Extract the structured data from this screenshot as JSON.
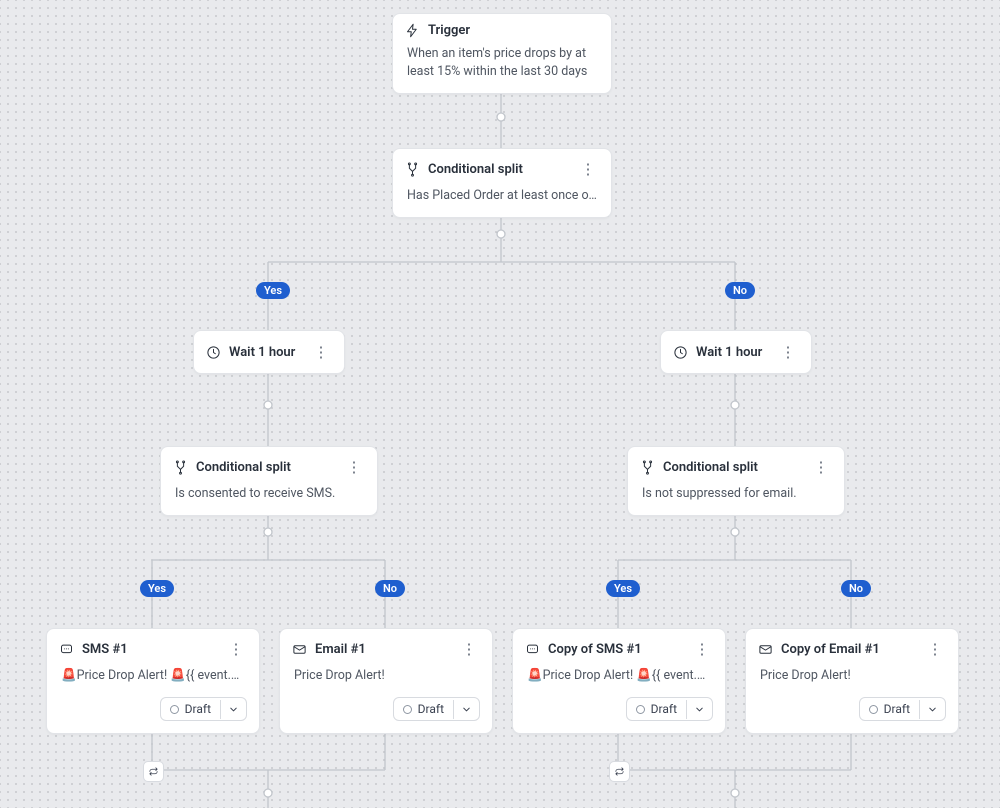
{
  "trigger": {
    "title": "Trigger",
    "desc": "When an item's price drops by at least 15% within the last 30 days"
  },
  "split1": {
    "title": "Conditional split",
    "desc": "Has Placed Order at least once over all ti…"
  },
  "branchLabels": {
    "yes": "Yes",
    "no": "No"
  },
  "waitL": {
    "title": "Wait 1 hour"
  },
  "waitR": {
    "title": "Wait 1 hour"
  },
  "split2L": {
    "title": "Conditional split",
    "desc": "Is consented to receive SMS."
  },
  "split2R": {
    "title": "Conditional split",
    "desc": "Is not suppressed for email."
  },
  "msg": {
    "sms1": {
      "title": "SMS #1",
      "desc": "🚨Price Drop Alert! 🚨{{ event.product_n…",
      "status": "Draft"
    },
    "email1": {
      "title": "Email #1",
      "desc": "Price Drop Alert!",
      "status": "Draft"
    },
    "sms2": {
      "title": "Copy of SMS #1",
      "desc": "🚨Price Drop Alert! 🚨{{ event.product_n…",
      "status": "Draft"
    },
    "email2": {
      "title": "Copy of Email #1",
      "desc": "Price Drop Alert!",
      "status": "Draft"
    }
  }
}
